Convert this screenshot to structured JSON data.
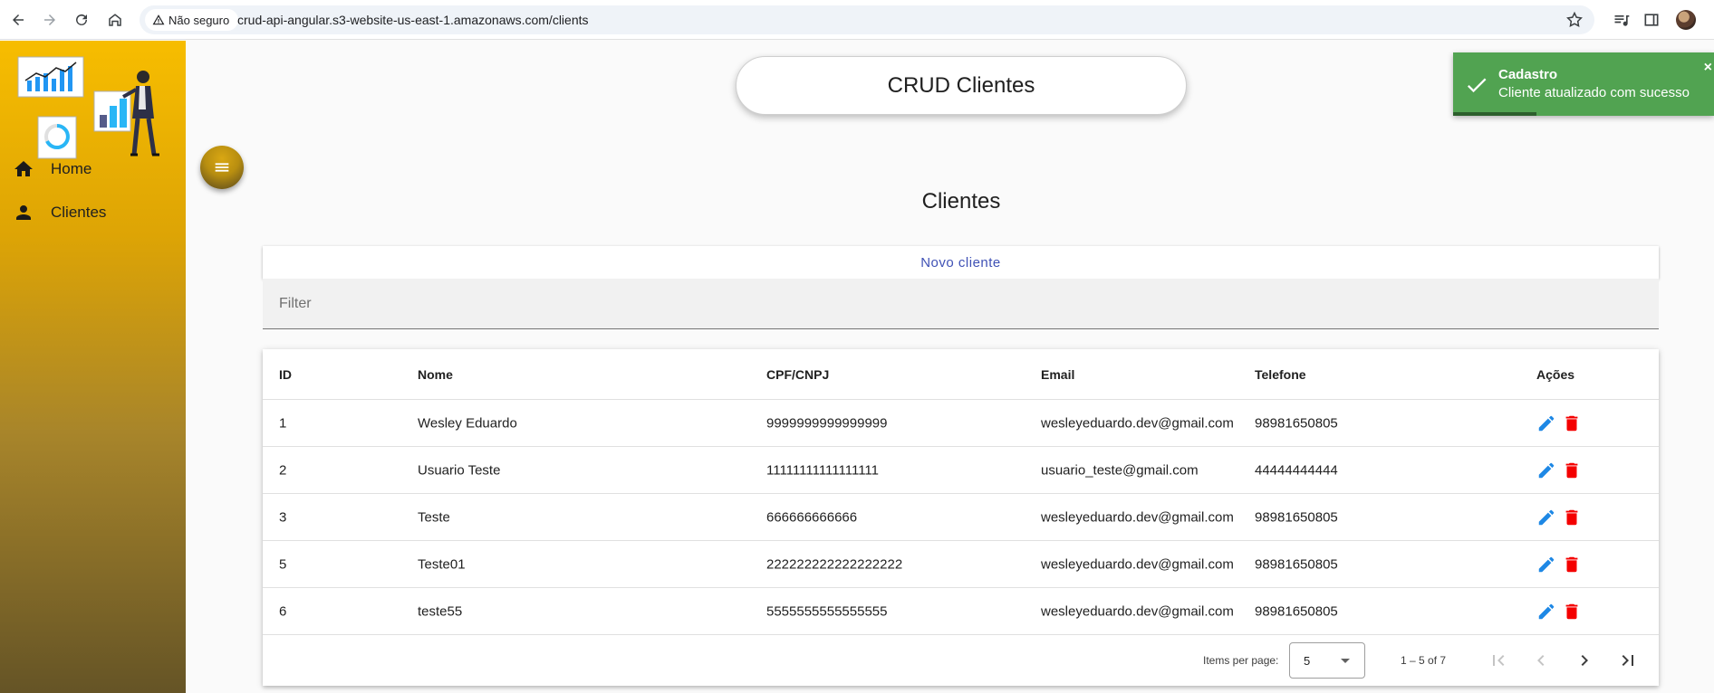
{
  "browser": {
    "security_label": "Não seguro",
    "url": "crud-api-angular.s3-website-us-east-1.amazonaws.com/clients"
  },
  "sidebar": {
    "items": [
      {
        "label": "Home",
        "icon": "home-icon"
      },
      {
        "label": "Clientes",
        "icon": "person-icon"
      }
    ]
  },
  "header": {
    "title": "CRUD Clientes"
  },
  "toast": {
    "title": "Cadastro",
    "message": "Cliente atualizado com sucesso",
    "close": "×",
    "color": "#51a351"
  },
  "main": {
    "heading": "Clientes",
    "new_client_label": "Novo cliente",
    "filter_placeholder": "Filter"
  },
  "table": {
    "columns": [
      "ID",
      "Nome",
      "CPF/CNPJ",
      "Email",
      "Telefone",
      "Ações"
    ],
    "rows": [
      {
        "id": "1",
        "nome": "Wesley Eduardo",
        "cpf": "9999999999999999",
        "email": "wesleyeduardo.dev@gmail.com",
        "telefone": "98981650805"
      },
      {
        "id": "2",
        "nome": "Usuario Teste",
        "cpf": "11111111111111111",
        "email": "usuario_teste@gmail.com",
        "telefone": "44444444444"
      },
      {
        "id": "3",
        "nome": "Teste",
        "cpf": "666666666666",
        "email": "wesleyeduardo.dev@gmail.com",
        "telefone": "98981650805"
      },
      {
        "id": "5",
        "nome": "Teste01",
        "cpf": "222222222222222222",
        "email": "wesleyeduardo.dev@gmail.com",
        "telefone": "98981650805"
      },
      {
        "id": "6",
        "nome": "teste55",
        "cpf": "5555555555555555",
        "email": "wesleyeduardo.dev@gmail.com",
        "telefone": "98981650805"
      }
    ],
    "action_colors": {
      "edit": "#1e88e5",
      "delete": "#f40000"
    }
  },
  "paginator": {
    "items_per_page_label": "Items per page:",
    "items_per_page": "5",
    "range": "1 – 5 of 7"
  }
}
